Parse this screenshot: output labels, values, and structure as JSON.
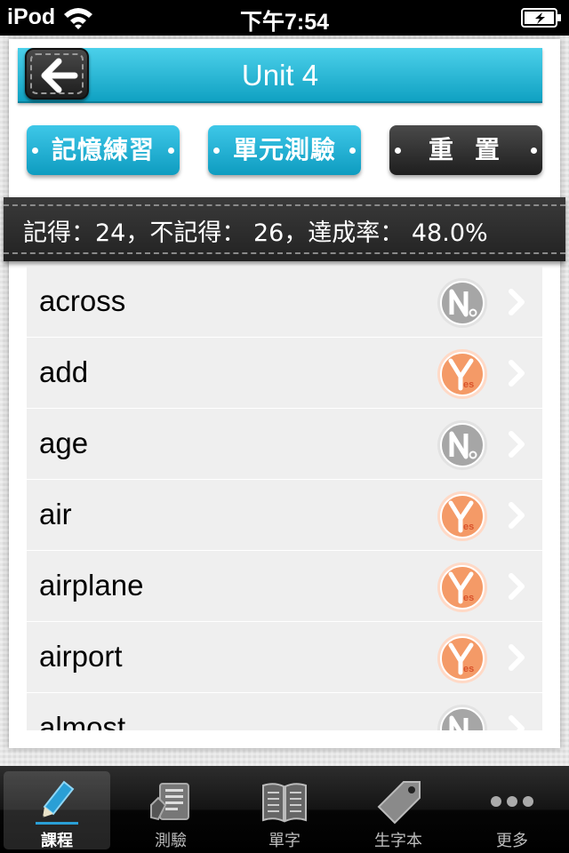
{
  "status_bar": {
    "carrier": "iPod",
    "time": "下午7:54"
  },
  "header": {
    "title": "Unit 4",
    "back_icon": "back-arrow-icon"
  },
  "actions": {
    "memory_practice": "記憶練習",
    "unit_test": "單元測驗",
    "reset": "重置"
  },
  "stats": {
    "text": "記得：24，不記得： 26，達成率： 48.0%",
    "remembered": 24,
    "not_remembered": 26,
    "rate": "48.0%"
  },
  "colors": {
    "accent": "#10a1c2",
    "yes": "#f08a55",
    "no": "#9a9a9a"
  },
  "words": [
    {
      "word": "across",
      "status": "no"
    },
    {
      "word": "add",
      "status": "yes"
    },
    {
      "word": "age",
      "status": "no"
    },
    {
      "word": "air",
      "status": "yes"
    },
    {
      "word": "airplane",
      "status": "yes"
    },
    {
      "word": "airport",
      "status": "yes"
    },
    {
      "word": "almost",
      "status": "no"
    }
  ],
  "tabs": [
    {
      "label": "課程",
      "icon": "pencil-icon",
      "active": true
    },
    {
      "label": "測驗",
      "icon": "quiz-icon",
      "active": false
    },
    {
      "label": "單字",
      "icon": "book-icon",
      "active": false
    },
    {
      "label": "生字本",
      "icon": "tag-icon",
      "active": false
    },
    {
      "label": "更多",
      "icon": "more-icon",
      "active": false
    }
  ]
}
